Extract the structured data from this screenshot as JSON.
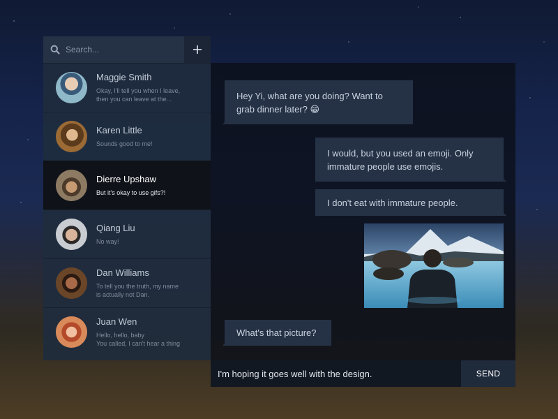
{
  "search": {
    "placeholder": "Search..."
  },
  "icons": {
    "search": "search-icon",
    "add": "plus-icon"
  },
  "contacts": [
    {
      "name": "Maggie Smith",
      "preview": "Okay, I'll tell you when I leave,\nthen you can leave at the...",
      "active": false,
      "avatar_color": "#6a9fb0"
    },
    {
      "name": "Karen Little",
      "preview": "Sounds good to me!",
      "active": false,
      "avatar_color": "#8a6a3a"
    },
    {
      "name": "Dierre Upshaw",
      "preview": "But it's okay to use gifs?!",
      "active": true,
      "avatar_color": "#7a6a52"
    },
    {
      "name": "Qiang Liu",
      "preview": "No way!",
      "active": false,
      "avatar_color": "#b0b4b8"
    },
    {
      "name": "Dan Williams",
      "preview": "To tell you the truth, my name\nis actually not Dan.",
      "active": false,
      "avatar_color": "#7a4a2a"
    },
    {
      "name": "Juan Wen",
      "preview": "Hello, hello, baby\nYou called, I can't hear a thing",
      "active": false,
      "avatar_color": "#c0603a"
    }
  ],
  "messages": [
    {
      "sender": "me",
      "text": "Hey Yi, what are you doing? Want to grab dinner later? 😁"
    },
    {
      "sender": "other",
      "text": "I would, but you used an emoji. Only immature people use emojis."
    },
    {
      "sender": "other",
      "text": "I don't eat with immature people."
    },
    {
      "sender": "other",
      "type": "image",
      "description": "person-by-lake-photo"
    },
    {
      "sender": "me",
      "text": "What's that picture?"
    }
  ],
  "compose": {
    "value": "I'm hoping it goes well with the design.",
    "send_label": "SEND"
  },
  "colors": {
    "panel": "#202c3e",
    "bubble": "#253246",
    "active_contact": "#0f1218"
  }
}
